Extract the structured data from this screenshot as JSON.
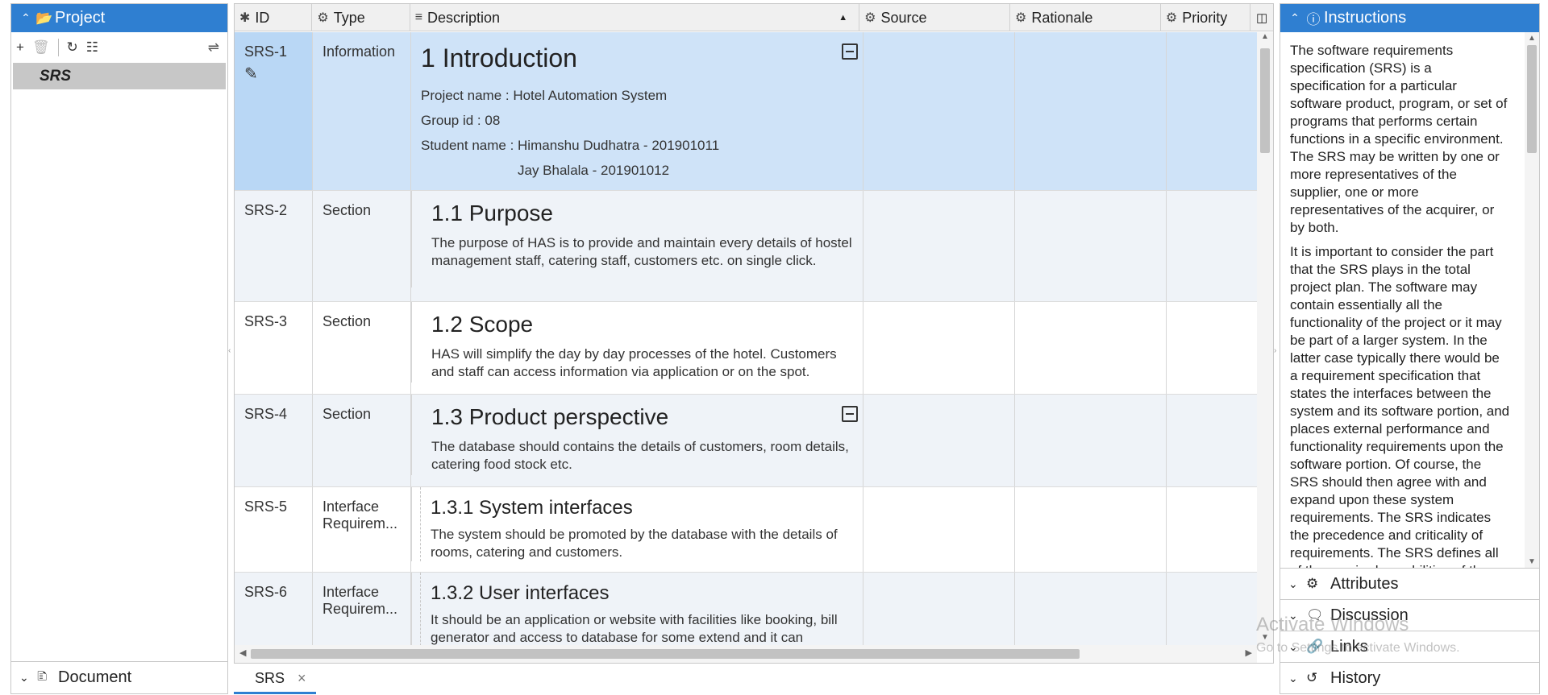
{
  "project_panel": {
    "title": "Project",
    "tree_selected": "SRS",
    "footer_label": "Document"
  },
  "grid": {
    "columns": {
      "id": "ID",
      "type": "Type",
      "description": "Description",
      "source": "Source",
      "rationale": "Rationale",
      "priority": "Priority"
    },
    "rows": [
      {
        "id": "SRS-1",
        "type": "Information",
        "heading": "1 Introduction",
        "lines": [
          "Project name : Hotel Automation System",
          "Group id : 08",
          "Student name : Himanshu Dudhatra - 201901011",
          "Jay Bhalala - 201901012"
        ]
      },
      {
        "id": "SRS-2",
        "type": "Section",
        "heading": "1.1 Purpose",
        "text": "The purpose of HAS is to provide and maintain every details of hostel management staff, catering staff, customers etc. on single click."
      },
      {
        "id": "SRS-3",
        "type": "Section",
        "heading": "1.2 Scope",
        "text": "HAS will simplify the day by day processes of the hotel. Customers and staff can access information via application or on the spot."
      },
      {
        "id": "SRS-4",
        "type": "Section",
        "heading": "1.3 Product perspective",
        "text": "The database should contains the details of customers, room details, catering food stock etc."
      },
      {
        "id": "SRS-5",
        "type": "Interface Requirem...",
        "heading": "1.3.1 System interfaces",
        "text": "The system should be promoted by the database with the details of rooms, catering and customers."
      },
      {
        "id": "SRS-6",
        "type": "Interface Requirem...",
        "heading": "1.3.2 User interfaces",
        "text": "It should be an application or website with facilities like booking, bill generator and access to database for some extend and it can"
      }
    ]
  },
  "doc_tab": {
    "label": "SRS",
    "close": "×"
  },
  "instructions": {
    "title": "Instructions",
    "paragraph1": "The software requirements specification (SRS) is a specification for a particular software product, program, or set of programs that performs certain functions in a specific environment. The SRS may be written by one or more representatives of the supplier, one or more representatives of the acquirer, or by both.",
    "paragraph2": "It is important to consider the part that the SRS plays in the total project plan. The software may contain essentially all the functionality of the project or it may be part of a larger system. In the latter case typically there would be a requirement specification that states the interfaces between the system and its software portion, and places external performance and functionality requirements upon the software portion. Of course, the SRS should then agree with and expand upon these system requirements. The SRS indicates the precedence and criticality of requirements. The SRS defines all of the required capabilities of the specified"
  },
  "accordion": {
    "attributes": "Attributes",
    "discussion": "Discussion",
    "links": "Links",
    "history": "History"
  },
  "watermark": {
    "line1": "Activate Windows",
    "line2": "Go to Settings to activate Windows."
  },
  "colors": {
    "accent": "#2f7fd1",
    "selected_row": "#cfe3f8",
    "alt_row": "#eff3f8"
  }
}
